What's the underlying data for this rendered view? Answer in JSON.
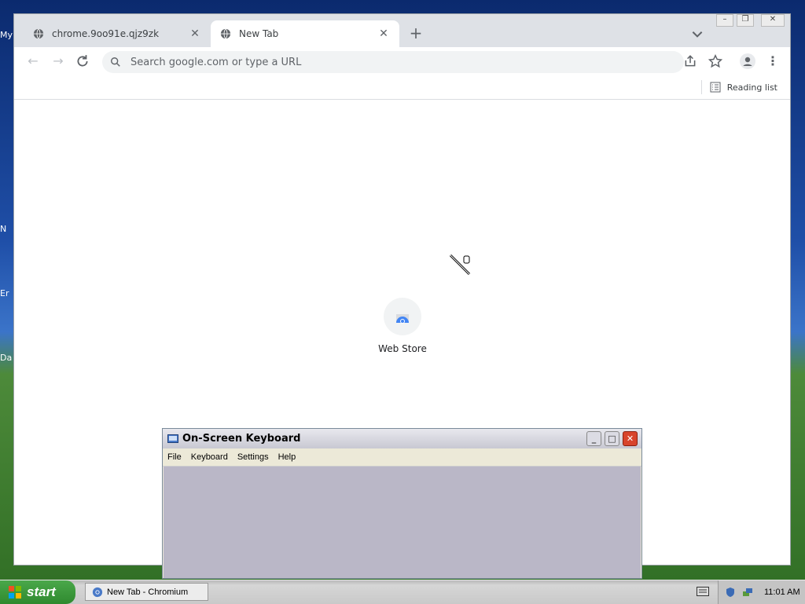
{
  "desktop": {
    "fragments": [
      "My",
      "N",
      "Er",
      "Da"
    ]
  },
  "browser": {
    "tabs": [
      {
        "title": "chrome.9oo91e.qjz9zk",
        "active": false
      },
      {
        "title": "New Tab",
        "active": true
      }
    ],
    "new_tab_glyph": "+",
    "window_controls": [
      "minimize",
      "restore",
      "close"
    ],
    "omnibox": {
      "placeholder": "Search google.com or type a URL",
      "value": ""
    },
    "bookmarks_bar": {
      "reading_list_label": "Reading list"
    },
    "new_tab_page": {
      "shortcuts": [
        {
          "label": "Web Store",
          "icon": "chrome-web-store-icon"
        }
      ]
    }
  },
  "osk": {
    "title": "On-Screen Keyboard",
    "menu": [
      "File",
      "Keyboard",
      "Settings",
      "Help"
    ]
  },
  "taskbar": {
    "start_label": "start",
    "tasks": [
      {
        "label": "New Tab - Chromium",
        "icon": "chromium-icon"
      }
    ],
    "clock": "11:01 AM"
  },
  "colors": {
    "tab_strip": "#dee1e6",
    "omnibox_bg": "#f1f3f4",
    "osk_body": "#bab7c7",
    "start_green": "#3a9a3a"
  }
}
